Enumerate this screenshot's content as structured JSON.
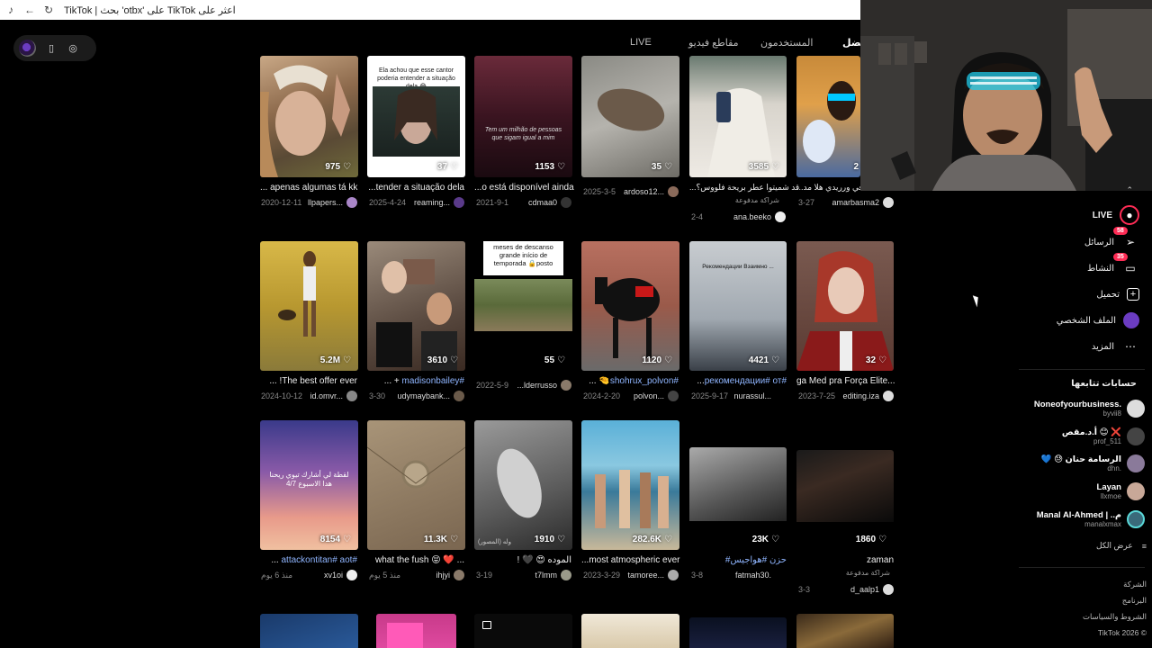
{
  "browser": {
    "title": "TikTok | بحث 'otbx' على TikTok اعثر على"
  },
  "tabs": [
    "LIVE",
    "مقاطع فيديو",
    "المستخدمون",
    "الأفضل"
  ],
  "grid": {
    "row1": [
      {
        "count": "975",
        "desc": "... apenas algumas tá kk",
        "date": "2020-12-11",
        "user": "llpapers..."
      },
      {
        "count": "37",
        "desc": "...tender a situação dela",
        "date": "2025-4-24",
        "user": "reaming...",
        "overlay": "Ela achou que esse cantor poderia entender a situação dela 😂"
      },
      {
        "count": "1153",
        "desc": "...o está disponível ainda",
        "date": "2021-9-1",
        "user": "cdmaa0",
        "overlay": "Tem um milhão de pessoas que sigam igual a mim"
      },
      {
        "count": "35",
        "desc": "",
        "date": "2025-3-5",
        "user": "ardoso12..."
      },
      {
        "count": "3585",
        "desc": "...قد شميتوا عطر بريحة فلووس؟",
        "sponsored": "شراكة مدفوعة",
        "date": "2-4",
        "user": "ana.beeko"
      },
      {
        "count": "2",
        "desc": "...شي في ورريدي هلا مد",
        "date": "3-27",
        "user": "amarbasma2"
      }
    ],
    "row2": [
      {
        "count": "5.2M",
        "desc": "... !The best offer ever",
        "date": "2024-10-12",
        "user": "id.omvr..."
      },
      {
        "count": "3610",
        "desc_hl": "madisonbailey#",
        "desc": "... + ",
        "date": "3-30",
        "user": "udymaybank..."
      },
      {
        "count": "55",
        "desc": "...lderrusso",
        "date": "2022-5-9",
        "user": "",
        "overlay": "meses de descanso grande início de temporada 🔒posto"
      },
      {
        "count": "1120",
        "desc_hl": "shohrux_polvon#",
        "desc": "... 🤏",
        "date": "2024-2-20",
        "user": "polvon..."
      },
      {
        "count": "4421",
        "desc_hl": "рекомендации# от#",
        "desc": "...",
        "date": "2025-9-17",
        "user": "nurassul...",
        "overlay": "Рекомендации Взаимно ..."
      },
      {
        "count": "32",
        "desc": "ga Med pra Força Elite...",
        "date": "2023-7-25",
        "user": "editing.iza"
      }
    ],
    "row3": [
      {
        "count": "8154",
        "desc_hl": "attackontitan# aot#",
        "desc": "...",
        "date": "منذ 6 يوم",
        "user": "xv1oi",
        "overlay": "لقطة لي أشارك تيوي ريحنا هدا الاسبوع 4/7"
      },
      {
        "count": "11.3K",
        "desc": "what the fush 😝 ❤️ ...",
        "date": "منذ 5 يوم",
        "user": "ihjyi"
      },
      {
        "count": "1910",
        "desc": "! 🖤 😍 الموده",
        "date": "3-19",
        "user": "t7lmm",
        "overlay": "وله (المصور)"
      },
      {
        "count": "282.6K",
        "desc": "...most atmospheric ever",
        "date": "2023-3-29",
        "user": "tamoree..."
      },
      {
        "count": "23K",
        "desc_hl": "#حزن #هواجيس",
        "desc": "",
        "date": "3-8",
        "user": "fatmah30."
      },
      {
        "count": "1860",
        "desc": "zaman",
        "sponsored": "شراكة مدفوعة",
        "date": "3-3",
        "user": "d_aalp1"
      }
    ]
  },
  "sidebar": {
    "nav": [
      {
        "label": "LIVE"
      },
      {
        "label": "الرسائل",
        "badge": "58"
      },
      {
        "label": "النشاط",
        "badge": "35"
      },
      {
        "label": "تحميل"
      },
      {
        "label": "الملف الشخصي"
      },
      {
        "label": "المزيد"
      }
    ],
    "following_title": "حسابات تتابعها",
    "accounts": [
      {
        "name": "Noneofyourbusiness.",
        "handle": "byvii8"
      },
      {
        "name": "أ.د.مقص 😊 ❌",
        "handle": "prof_511"
      },
      {
        "name": "💙 😓 الرسامة حنان",
        "handle": "dhn."
      },
      {
        "name": "Layan",
        "handle": "llxmoe"
      },
      {
        "name": "Manal Al-Ahmed | ..م",
        "handle": "manalxmax"
      }
    ],
    "see_all": "عرض الكل",
    "footer": [
      "الشركة",
      "البرنامج",
      "الشروط والسياسات",
      "TikTok 2026 ©"
    ]
  }
}
